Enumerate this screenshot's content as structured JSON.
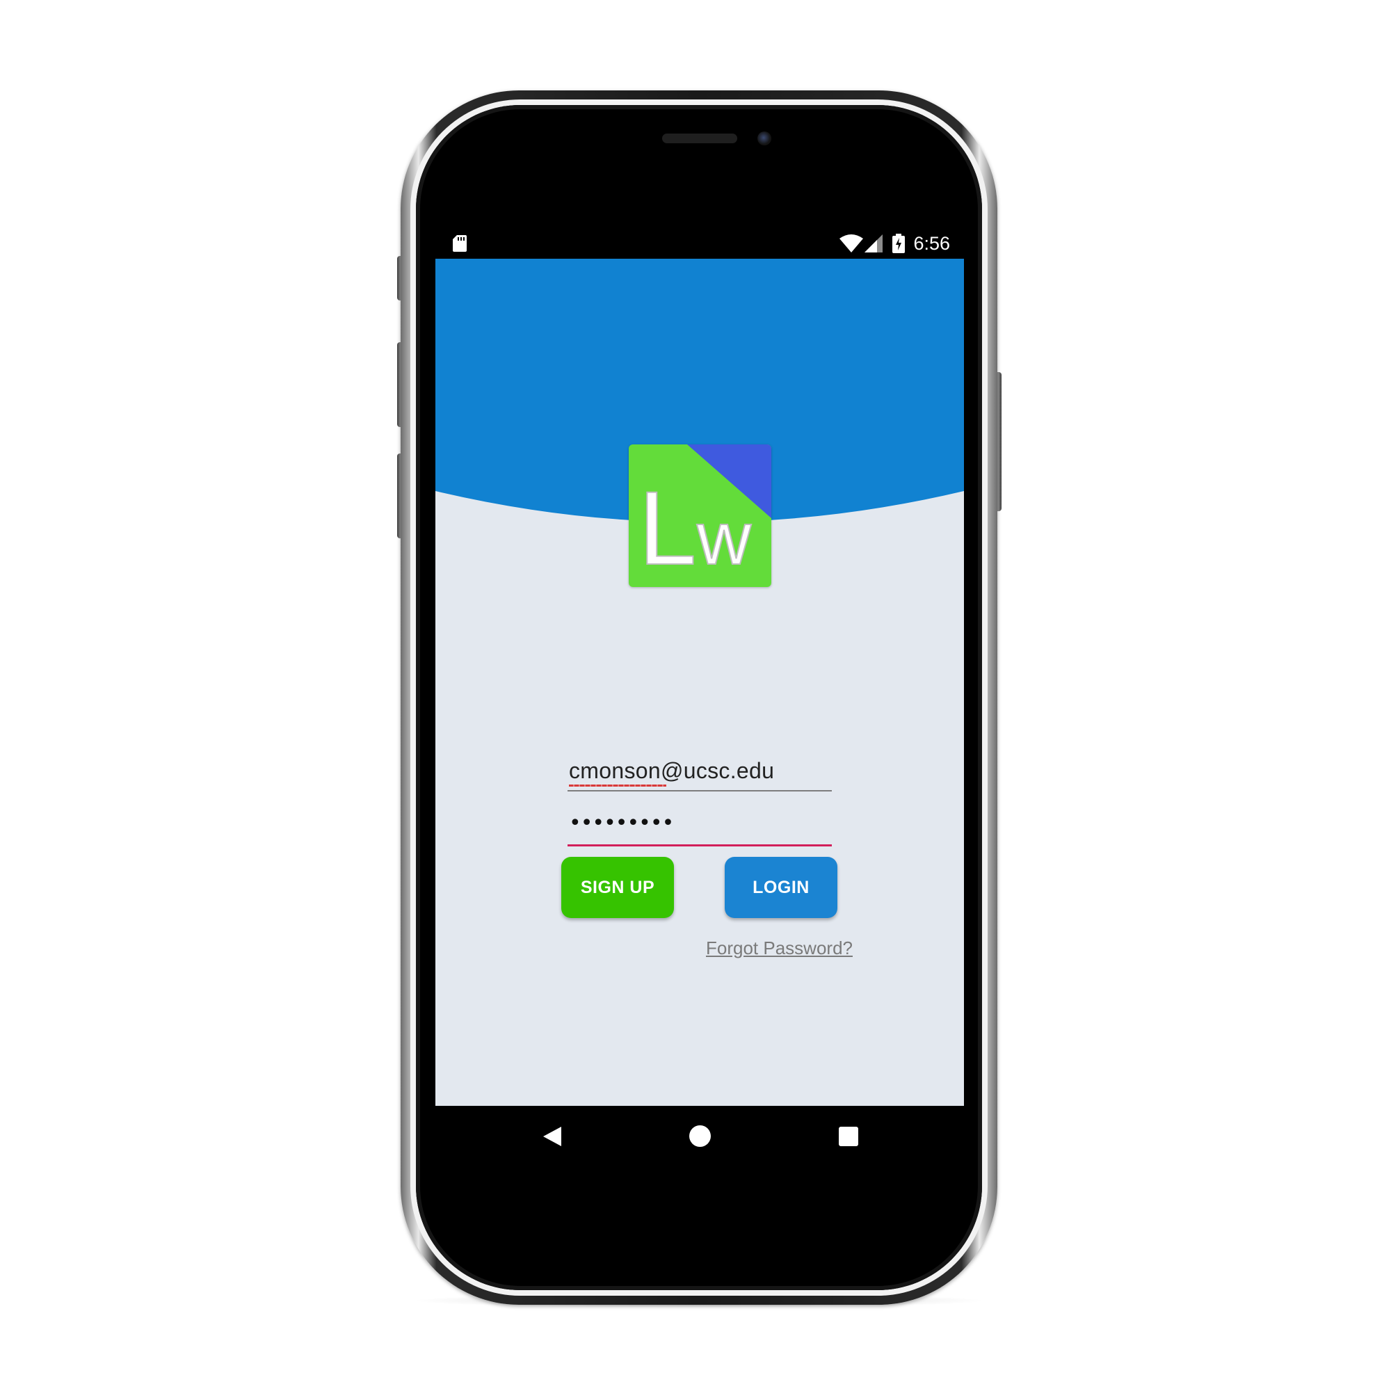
{
  "status_bar": {
    "time": "6:56",
    "icons": [
      "sd-card-icon",
      "wifi-icon",
      "cellular-signal-icon",
      "battery-charging-icon"
    ]
  },
  "app": {
    "logo_text": "Lw",
    "colors": {
      "header_blue": "#1182d1",
      "background": "#e3e8ef",
      "logo_green": "#63dc3a",
      "logo_corner": "#3f5adf",
      "signup_green": "#36c300",
      "login_blue": "#1b84d2",
      "focus_underline": "#d21f5a"
    }
  },
  "login_form": {
    "email_value": "cmonson@ucsc.edu",
    "password_value": "•••••••••",
    "signup_label": "SIGN UP",
    "login_label": "LOGIN",
    "forgot_label": "Forgot Password?"
  },
  "nav_bar": {
    "icons": [
      "back-icon",
      "home-icon",
      "recents-icon"
    ]
  }
}
